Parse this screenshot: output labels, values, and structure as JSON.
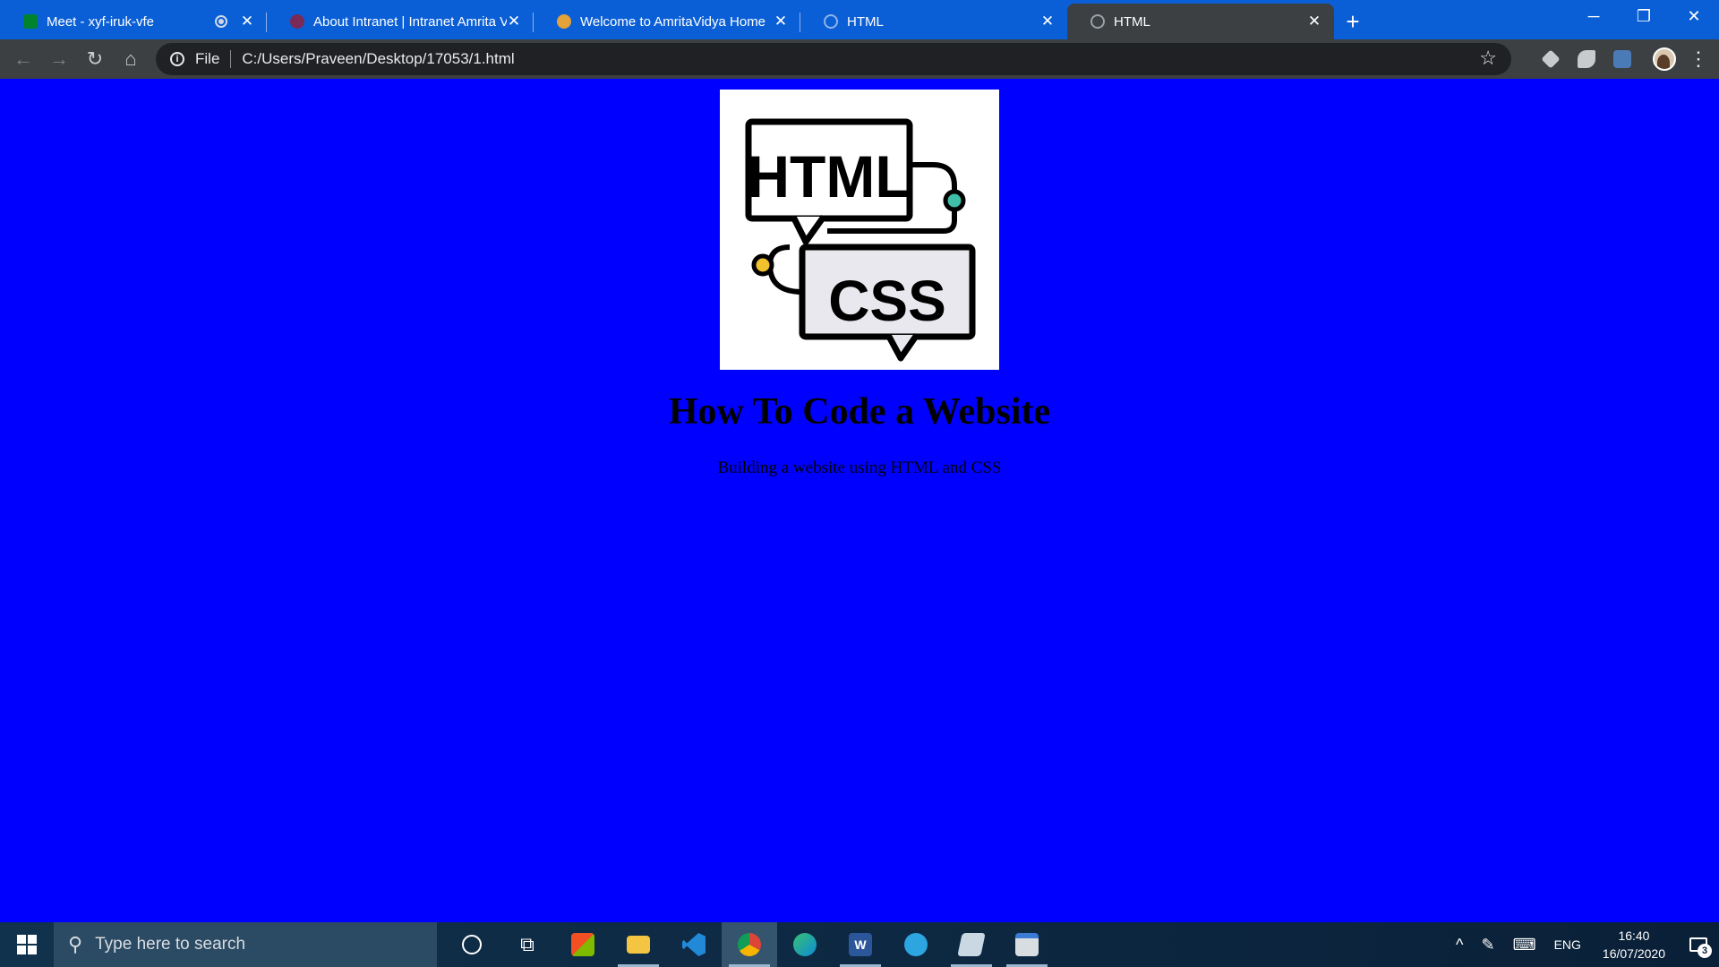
{
  "browser": {
    "tabs": [
      {
        "title": "Meet - xyf-iruk-vfe",
        "favicon": "google-meet-icon",
        "active": false,
        "recording": true
      },
      {
        "title": "About Intranet | Intranet Amrita V",
        "favicon": "amrita-icon",
        "active": false
      },
      {
        "title": "Welcome to AmritaVidya Home",
        "favicon": "amritavidya-icon",
        "active": false
      },
      {
        "title": "HTML",
        "favicon": "globe-icon",
        "active": false
      },
      {
        "title": "HTML",
        "favicon": "globe-icon",
        "active": true
      }
    ],
    "new_tab": "+",
    "window_controls": {
      "minimize": "─",
      "restore": "❐",
      "close": "✕"
    },
    "toolbar": {
      "back": "←",
      "forward": "→",
      "reload": "↻",
      "home": "⌂",
      "site_info": "i",
      "scheme_label": "File",
      "url": "C:/Users/Praveen/Desktop/17053/1.html",
      "bookmark": "☆",
      "menu": "⋮"
    }
  },
  "page": {
    "logo": {
      "top_text": "HTML",
      "bottom_text": "CSS"
    },
    "title": "How To Code a Website",
    "subtitle": "Building a website using HTML and CSS"
  },
  "taskbar": {
    "search_placeholder": "Type here to search",
    "language": "ENG",
    "time": "16:40",
    "date": "16/07/2020",
    "notification_count": "3"
  },
  "colors": {
    "page_background": "#0000ff",
    "tabstrip": "#0a5fd6",
    "toolbar": "#3c4043"
  }
}
